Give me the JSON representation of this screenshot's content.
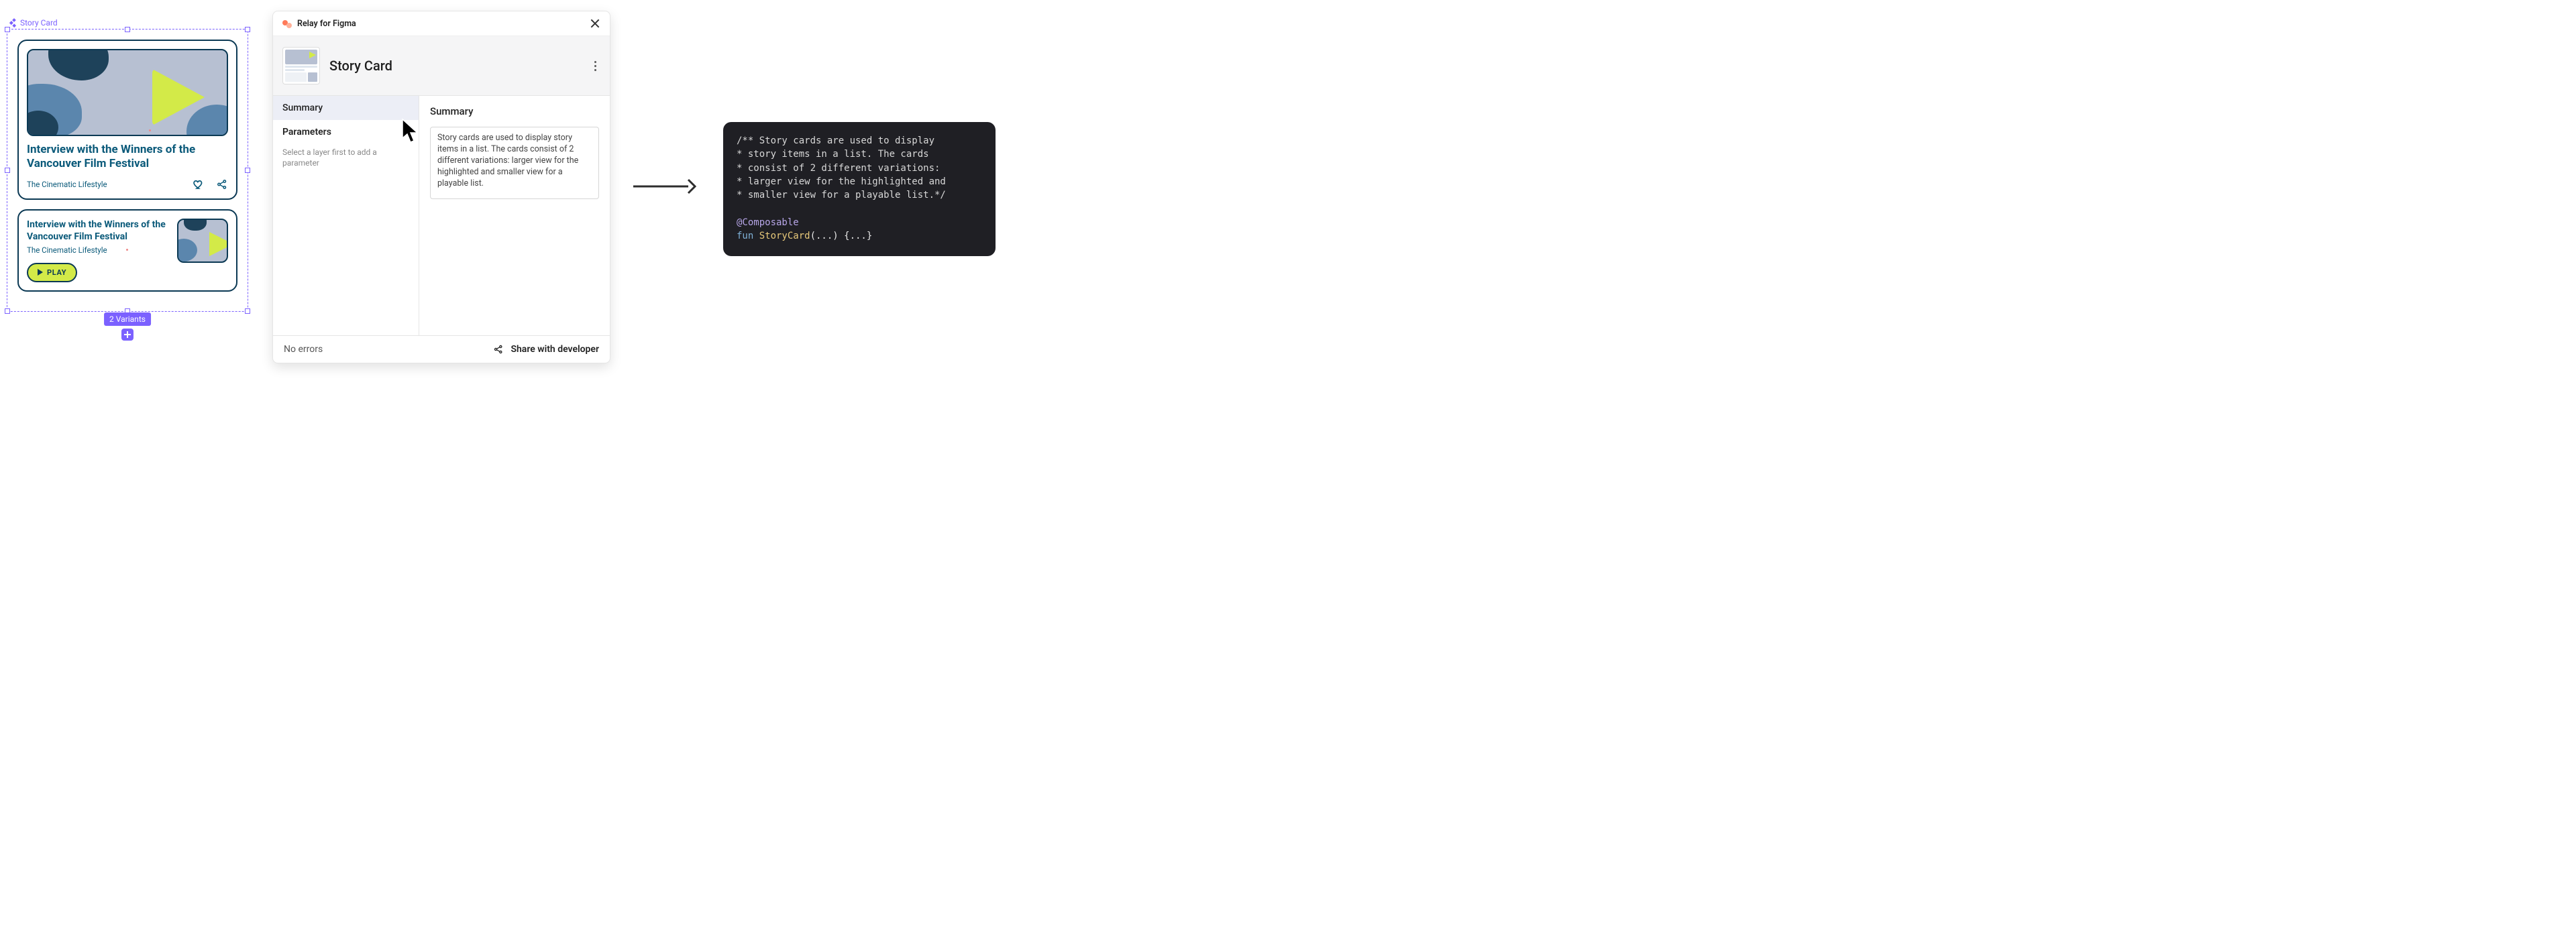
{
  "figma": {
    "component_label": "Story Card",
    "variants_badge": "2 Variants",
    "cardA": {
      "title": "Interview with the Winners of the Vancouver Film Festival",
      "subtitle": "The Cinematic Lifestyle"
    },
    "cardB": {
      "title": "Interview with the Winners of the Vancouver Film Festival",
      "subtitle": "The Cinematic Lifestyle",
      "play_label": "PLAY"
    }
  },
  "relay": {
    "brand": "Relay for Figma",
    "title": "Story Card",
    "side": {
      "summary": "Summary",
      "parameters": "Parameters",
      "help": "Select a layer first to add a parameter"
    },
    "main": {
      "heading": "Summary",
      "textarea": "Story cards are used to display story items in a list. The cards consist of 2 different variations: larger view for the highlighted and smaller view for a playable list."
    },
    "footer": {
      "status": "No errors",
      "share": "Share with developer"
    }
  },
  "code": {
    "l1": "/** Story cards are used to display",
    "l2": "* story items in a list. The cards",
    "l3": "* consist of 2 different variations:",
    "l4": "* larger view for the highlighted and",
    "l5": "* smaller view for a playable list.*/",
    "anno": "@Composable",
    "kw": "fun ",
    "fn": "StoryCard",
    "rest": "(...) {...}"
  }
}
